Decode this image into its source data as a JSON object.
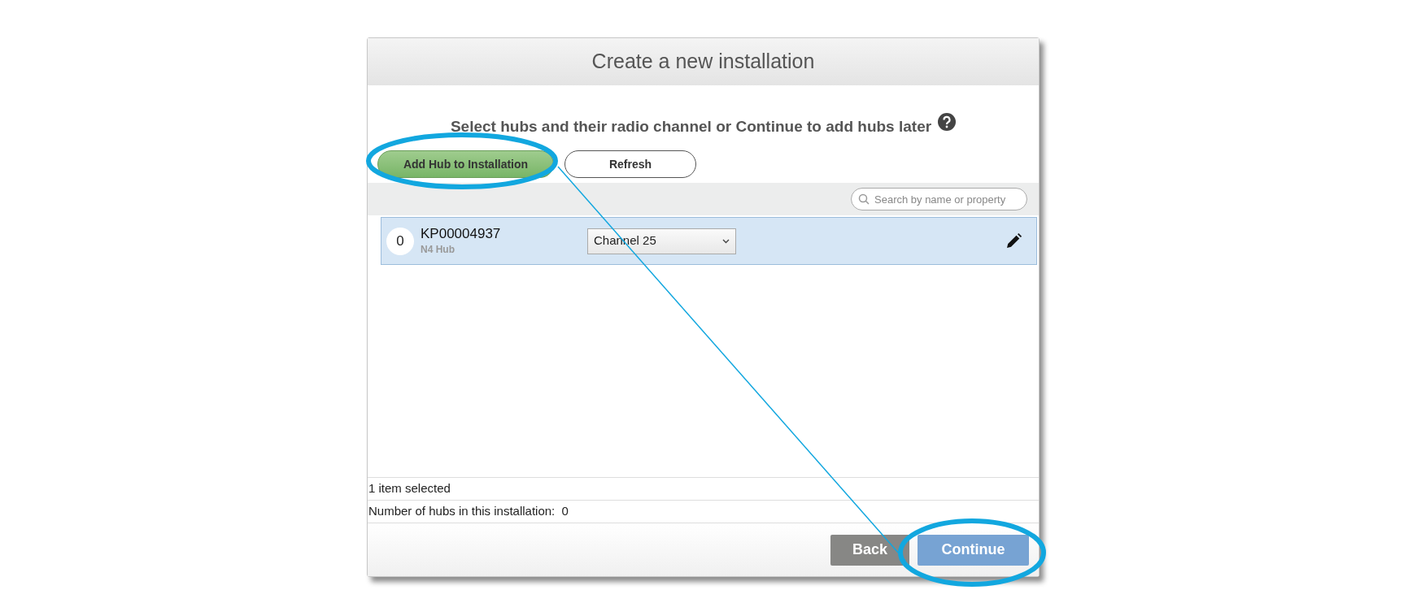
{
  "dialog": {
    "title": "Create a new installation"
  },
  "instruction": "Select hubs and their radio channel or Continue to add hubs later",
  "toolbar_buttons": [
    {
      "label": "Add Hub to Installation",
      "kind": "primary"
    },
    {
      "label": "Refresh",
      "kind": "outline"
    }
  ],
  "search": {
    "placeholder": "Search by name or property"
  },
  "hubs": [
    {
      "index": "0",
      "serial": "KP00004937",
      "type": "N4 Hub",
      "channel": "Channel 25",
      "selected": true
    }
  ],
  "status": [
    {
      "text": "1 item selected"
    },
    {
      "text": "Number of hubs in this installation:  0"
    }
  ],
  "footer_buttons": [
    {
      "label": "Back",
      "kind": "secondary"
    },
    {
      "label": "Continue",
      "kind": "primary"
    }
  ]
}
